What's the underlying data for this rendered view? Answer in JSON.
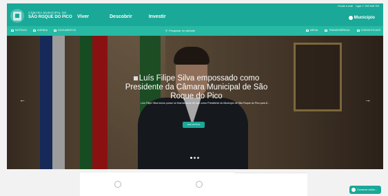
{
  "header": {
    "brand_line1": "CÂMARA MUNICIPAL DE",
    "brand_line2": "SÃO ROQUE DO PICO",
    "nav": [
      "Viver",
      "Descobrir",
      "Investir"
    ],
    "contact_email": "Enviar e-mail",
    "contact_phone": "Ligar ☐ 292 648 700",
    "municipio": "Município"
  },
  "subnav": {
    "left": [
      "NOTÍCIAS",
      "AGENDA",
      "DOCUMENTOS"
    ],
    "search_placeholder": "Pesquisar no website",
    "right": [
      "MEDIA",
      "TRANSPARÊNCIA",
      "CONTACTE-NOS"
    ]
  },
  "hero": {
    "title": "Luís Filipe Silva empossado como Presidente da Câmara Municipal de São Roque do Pico",
    "description": "Luís Filipe Silva tomou posse no final da tarde de hoje como Presidente do Município de São Roque do Pico para 8...",
    "button": "LER NOTÍCIA",
    "slides": 3,
    "active_slide": 0
  },
  "chat": {
    "label": "Converse online..."
  },
  "colors": {
    "primary": "#1aa898",
    "secondary": "#27b9a3"
  }
}
